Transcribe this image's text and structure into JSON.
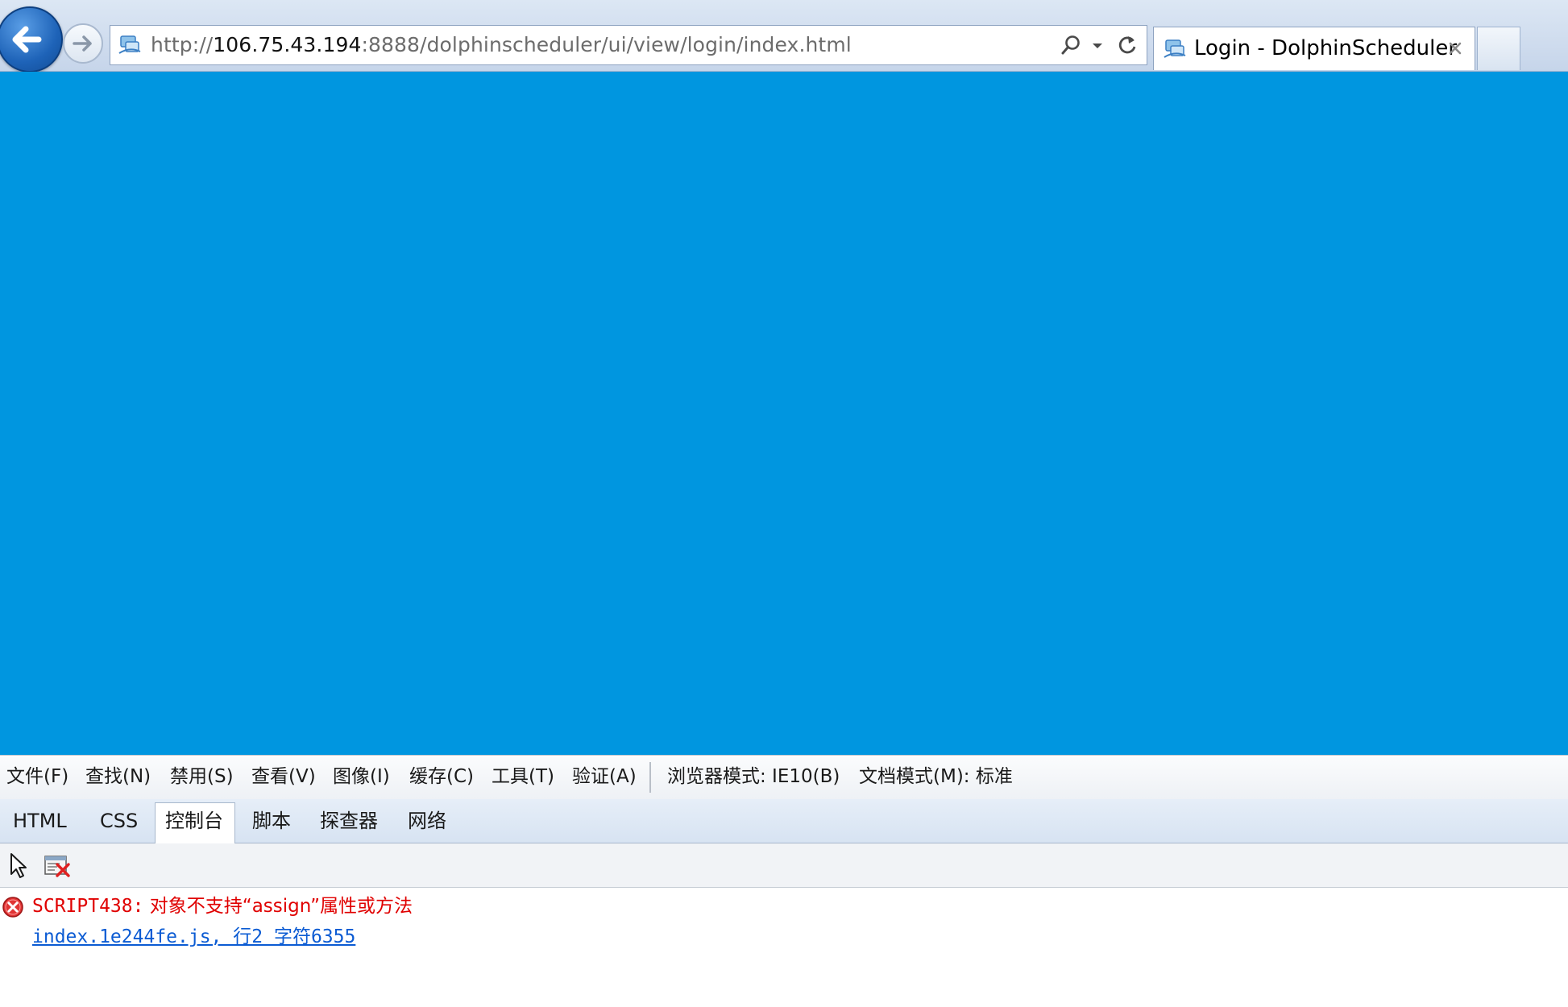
{
  "browser": {
    "url": {
      "scheme": "http://",
      "host": "106.75.43.194",
      "path": ":8888/dolphinscheduler/ui/view/login/index.html"
    },
    "tab_title": "Login - DolphinScheduler",
    "icons": {
      "back": "back-arrow-icon",
      "forward": "forward-arrow-icon",
      "page": "ie-page-icon",
      "search": "search-icon",
      "dropdown": "chevron-down-icon",
      "refresh": "refresh-icon",
      "close": "close-icon"
    }
  },
  "page": {
    "background": "#0096e0"
  },
  "devtools": {
    "menu": [
      "文件(F)",
      "查找(N)",
      "禁用(S)",
      "查看(V)",
      "图像(I)",
      "缓存(C)",
      "工具(T)",
      "验证(A)",
      "浏览器模式: IE10(B)",
      "文档模式(M): 标准"
    ],
    "tabs": [
      "HTML",
      "CSS",
      "控制台",
      "脚本",
      "探查器",
      "网络"
    ],
    "active_tab": "控制台",
    "console": {
      "error_code": "SCRIPT438:",
      "error_text": "对象不支持“assign”属性或方法",
      "error_source": "index.1e244fe.js, 行2 字符6355",
      "error_color": "#e00000",
      "link_color": "#0b5bd3"
    }
  }
}
